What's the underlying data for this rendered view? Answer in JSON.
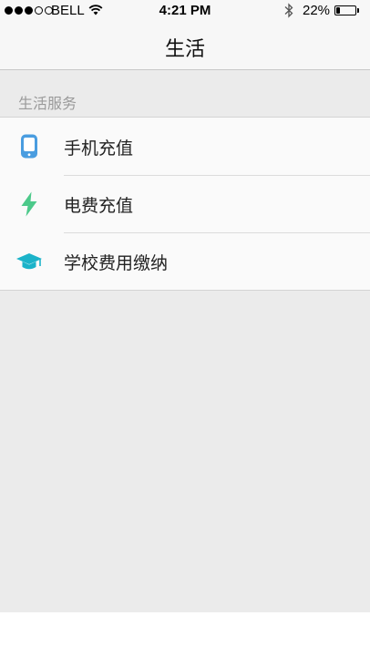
{
  "status_bar": {
    "carrier": "BELL",
    "signal_bars_filled": 3,
    "signal_bars_total": 5,
    "time": "4:21 PM",
    "battery_percent": "22%",
    "battery_level": 0.22
  },
  "nav": {
    "title": "生活"
  },
  "section": {
    "header": "生活服务",
    "items": [
      {
        "label": "手机充值",
        "icon": "phone-icon",
        "color": "#4a9de0"
      },
      {
        "label": "电费充值",
        "icon": "lightning-icon",
        "color": "#4cc98a"
      },
      {
        "label": "学校费用缴纳",
        "icon": "graduation-cap-icon",
        "color": "#1bb3c9"
      }
    ]
  }
}
